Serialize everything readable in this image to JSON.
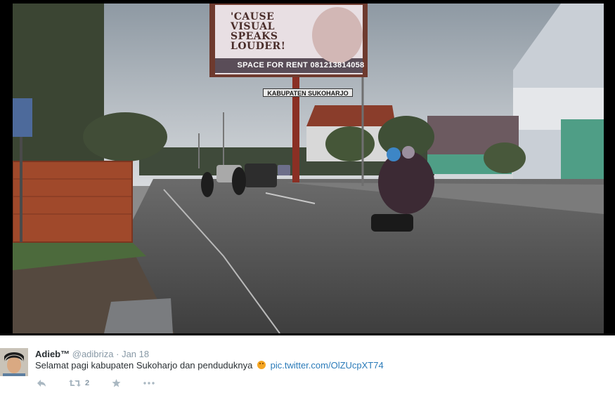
{
  "photo": {
    "billboard": {
      "lines": [
        "'CAUSE",
        "VISUAL",
        "SPEAKS",
        "LOUDER!"
      ],
      "rent": "SPACE FOR RENT 081213814058"
    },
    "street_sign": "KABUPATEN SUKOHARJO"
  },
  "tweet": {
    "author_name": "Adieb™",
    "handle": "@adibriza",
    "separator": "·",
    "timestamp": "Jan 18",
    "text": "Selamat pagi kabupaten Sukoharjo dan penduduknya",
    "link": "pic.twitter.com/OlZUcpXT74",
    "retweet_count": "2"
  },
  "icons": {
    "reply": "reply-icon",
    "retweet": "retweet-icon",
    "favorite": "star-icon",
    "more": "more-icon",
    "emoji": "smiley-emoji-icon"
  },
  "colors": {
    "link": "#2b7bb9",
    "meta": "#8899a6",
    "text": "#292f33"
  }
}
